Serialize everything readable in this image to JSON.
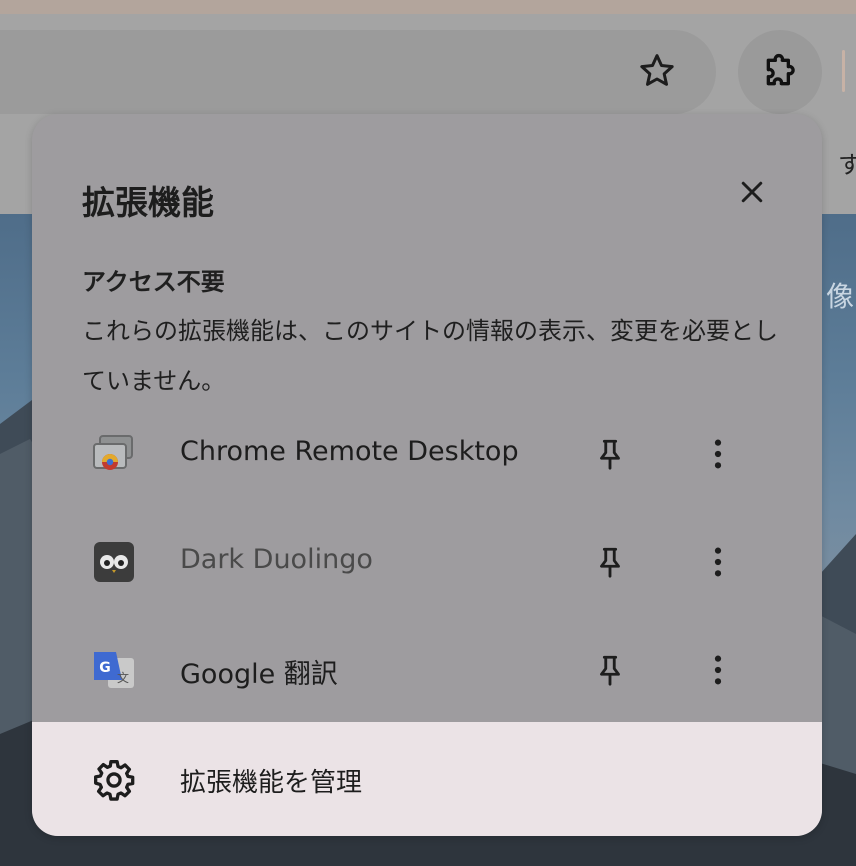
{
  "toolbar": {
    "bookmark_star_icon": "star-outline-icon",
    "extensions_icon": "puzzle-piece-icon",
    "bookmark_bar_partial_text": "す",
    "background_partial_text": "像"
  },
  "panel": {
    "title": "拡張機能",
    "close_icon": "close-icon",
    "section": {
      "heading": "アクセス不要",
      "description": "これらの拡張機能は、このサイトの情報の表示、変更を必要としていません。"
    },
    "extensions": [
      {
        "name": "Chrome Remote Desktop",
        "icon": "chrome-remote-desktop-icon",
        "dimmed": false
      },
      {
        "name": "Dark Duolingo",
        "icon": "dark-duolingo-icon",
        "dimmed": true
      },
      {
        "name": "Google 翻訳",
        "icon": "google-translate-icon",
        "dimmed": false
      }
    ],
    "pin_icon": "pin-icon",
    "more_icon": "more-vertical-icon",
    "manage": {
      "label": "拡張機能を管理",
      "icon": "gear-icon"
    }
  },
  "colors": {
    "panel_bg": "#9e9c9f",
    "manage_bg": "#ebe3e6",
    "text": "#1d1d1d"
  }
}
